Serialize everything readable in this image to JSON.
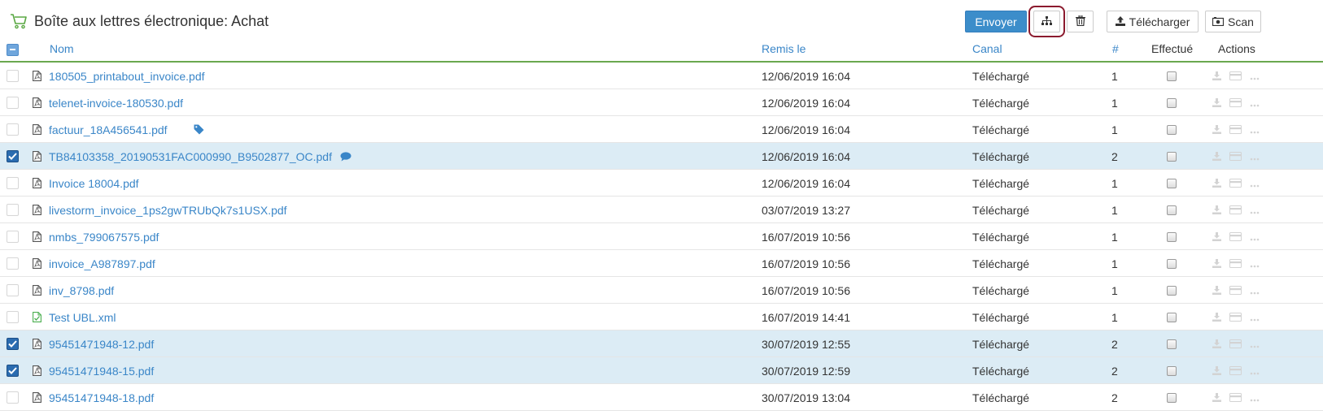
{
  "header": {
    "title": "Boîte aux lettres électronique: Achat",
    "cart_icon": "cart-icon",
    "buttons": {
      "send": "Envoyer",
      "hierarchy_icon": "sitemap-icon",
      "delete_icon": "trash-icon",
      "upload": "Télécharger",
      "scan": "Scan"
    }
  },
  "table": {
    "columns": {
      "name": "Nom",
      "submitted": "Remis le",
      "channel": "Canal",
      "count": "#",
      "done": "Effectué",
      "actions": "Actions"
    },
    "rows": [
      {
        "name": "180505_printabout_invoice.pdf",
        "date": "12/06/2019 16:04",
        "channel": "Téléchargé",
        "count": "1",
        "selected": false,
        "file_icon": "pdf-file-icon",
        "extra_icon": ""
      },
      {
        "name": "telenet-invoice-180530.pdf",
        "date": "12/06/2019 16:04",
        "channel": "Téléchargé",
        "count": "1",
        "selected": false,
        "file_icon": "pdf-file-icon",
        "extra_icon": ""
      },
      {
        "name": "factuur_18A456541.pdf",
        "date": "12/06/2019 16:04",
        "channel": "Téléchargé",
        "count": "1",
        "selected": false,
        "file_icon": "pdf-file-icon",
        "extra_icon": "tag-icon"
      },
      {
        "name": "TB84103358_20190531FAC000990_B9502877_OC.pdf",
        "date": "12/06/2019 16:04",
        "channel": "Téléchargé",
        "count": "2",
        "selected": true,
        "file_icon": "pdf-file-icon",
        "extra_icon": "comment-icon"
      },
      {
        "name": "Invoice 18004.pdf",
        "date": "12/06/2019 16:04",
        "channel": "Téléchargé",
        "count": "1",
        "selected": false,
        "file_icon": "pdf-file-icon",
        "extra_icon": ""
      },
      {
        "name": "livestorm_invoice_1ps2gwTRUbQk7s1USX.pdf",
        "date": "03/07/2019 13:27",
        "channel": "Téléchargé",
        "count": "1",
        "selected": false,
        "file_icon": "pdf-file-icon",
        "extra_icon": ""
      },
      {
        "name": "nmbs_799067575.pdf",
        "date": "16/07/2019 10:56",
        "channel": "Téléchargé",
        "count": "1",
        "selected": false,
        "file_icon": "pdf-file-icon",
        "extra_icon": ""
      },
      {
        "name": "invoice_A987897.pdf",
        "date": "16/07/2019 10:56",
        "channel": "Téléchargé",
        "count": "1",
        "selected": false,
        "file_icon": "pdf-file-icon",
        "extra_icon": ""
      },
      {
        "name": "inv_8798.pdf",
        "date": "16/07/2019 10:56",
        "channel": "Téléchargé",
        "count": "1",
        "selected": false,
        "file_icon": "pdf-file-icon",
        "extra_icon": ""
      },
      {
        "name": "Test UBL.xml",
        "date": "16/07/2019 14:41",
        "channel": "Téléchargé",
        "count": "1",
        "selected": false,
        "file_icon": "xml-file-icon",
        "extra_icon": ""
      },
      {
        "name": "95451471948-12.pdf",
        "date": "30/07/2019 12:55",
        "channel": "Téléchargé",
        "count": "2",
        "selected": true,
        "file_icon": "pdf-file-icon",
        "extra_icon": ""
      },
      {
        "name": "95451471948-15.pdf",
        "date": "30/07/2019 12:59",
        "channel": "Téléchargé",
        "count": "2",
        "selected": true,
        "file_icon": "pdf-file-icon",
        "extra_icon": ""
      },
      {
        "name": "95451471948-18.pdf",
        "date": "30/07/2019 13:04",
        "channel": "Téléchargé",
        "count": "2",
        "selected": false,
        "file_icon": "pdf-file-icon",
        "extra_icon": ""
      }
    ]
  },
  "colors": {
    "primary": "#3c8dca",
    "link": "#3a86c8",
    "header_rule": "#6aa84f",
    "selected_row": "#dcecf5",
    "highlight_frame": "#8b1a2e",
    "xml_icon": "#4caf50"
  }
}
